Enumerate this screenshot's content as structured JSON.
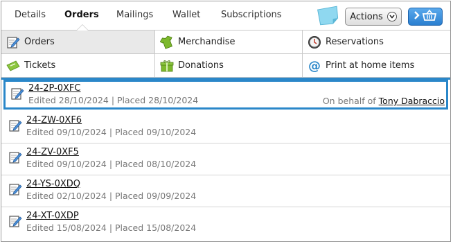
{
  "tabs": [
    {
      "label": "Details",
      "active": false
    },
    {
      "label": "Orders",
      "active": true
    },
    {
      "label": "Mailings",
      "active": false
    },
    {
      "label": "Wallet",
      "active": false
    },
    {
      "label": "Subscriptions",
      "active": false
    }
  ],
  "toolbar": {
    "actions_label": "Actions",
    "sticky_note_icon": "sticky-note-icon",
    "basket_icon": "basket-icon"
  },
  "subnav": [
    {
      "label": "Orders",
      "icon": "order-edit-icon",
      "selected": true
    },
    {
      "label": "Merchandise",
      "icon": "shirt-icon",
      "selected": false
    },
    {
      "label": "Reservations",
      "icon": "clock-icon",
      "selected": false
    },
    {
      "label": "Tickets",
      "icon": "ticket-icon",
      "selected": false
    },
    {
      "label": "Donations",
      "icon": "gift-icon",
      "selected": false
    },
    {
      "label": "Print at home items",
      "icon": "at-icon",
      "selected": false
    }
  ],
  "orders": [
    {
      "number": "24-2P-0XFC",
      "dates": "Edited 28/10/2024 | Placed 28/10/2024",
      "behalf_prefix": "On behalf of",
      "behalf_name": "Tony Dabraccio",
      "selected": true
    },
    {
      "number": "24-ZW-0XF6",
      "dates": "Edited 09/10/2024 | Placed 09/10/2024",
      "selected": false
    },
    {
      "number": "24-ZV-0XF5",
      "dates": "Edited 09/10/2024 | Placed 08/10/2024",
      "selected": false
    },
    {
      "number": "24-YS-0XDQ",
      "dates": "Edited 02/10/2024 | Placed 09/09/2024",
      "selected": false
    },
    {
      "number": "24-XT-0XDP",
      "dates": "Edited 15/08/2024 | Placed 15/08/2024",
      "selected": false
    }
  ],
  "colors": {
    "accent": "#2a87c9",
    "selected_cell": "#e9e9e9",
    "basket_button": "#3b8fdc"
  }
}
